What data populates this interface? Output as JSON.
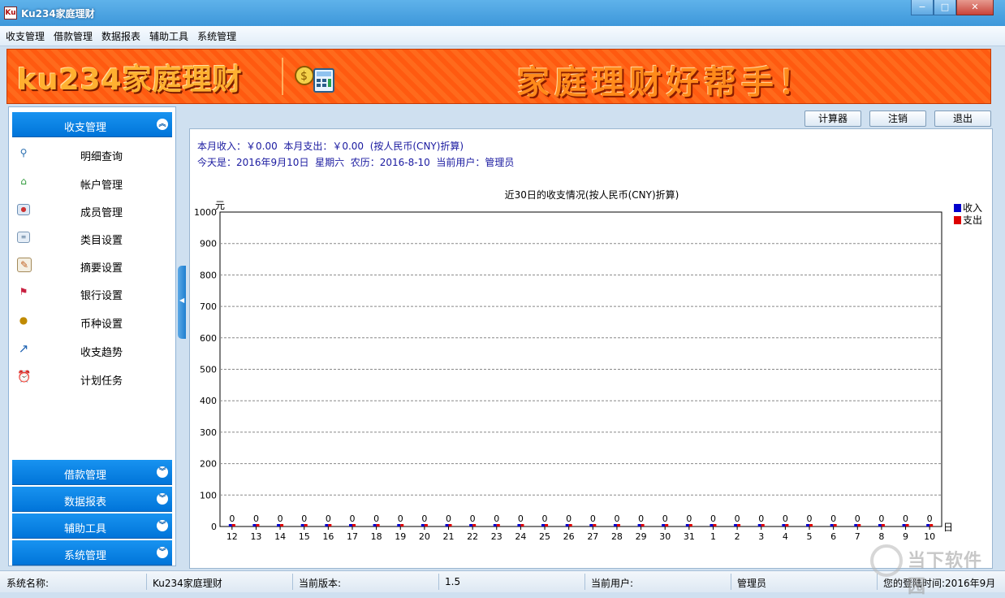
{
  "window": {
    "title": "Ku234家庭理财",
    "icon_text": "Ku",
    "buttons": [
      "−",
      "□",
      "✕"
    ]
  },
  "menubar": {
    "items": [
      "收支管理",
      "借款管理",
      "数据报表",
      "辅助工具",
      "系统管理"
    ]
  },
  "banner": {
    "logo": "ku234家庭理财",
    "slogan": "家庭理财好帮手！"
  },
  "sidebar": {
    "open_section": "收支管理",
    "items": [
      {
        "label": "明细查询",
        "icon": "search-icon"
      },
      {
        "label": "帐户管理",
        "icon": "home-icon"
      },
      {
        "label": "成员管理",
        "icon": "id-card-icon"
      },
      {
        "label": "类目设置",
        "icon": "list-box-icon"
      },
      {
        "label": "摘要设置",
        "icon": "pencil-note-icon"
      },
      {
        "label": "银行设置",
        "icon": "bank-icon"
      },
      {
        "label": "币种设置",
        "icon": "money-bag-icon"
      },
      {
        "label": "收支趋势",
        "icon": "trend-arrow-icon"
      },
      {
        "label": "计划任务",
        "icon": "alarm-clock-icon"
      }
    ],
    "sections": [
      "借款管理",
      "数据报表",
      "辅助工具",
      "系统管理"
    ]
  },
  "toolbar": {
    "calculator": "计算器",
    "logout": "注销",
    "exit": "退出"
  },
  "info": {
    "line1": "本月收入：￥0.00  本月支出：￥0.00  (按人民币(CNY)折算)",
    "line2": "今天是：2016年9月10日  星期六  农历：2016-8-10  当前用户：管理员"
  },
  "chart_data": {
    "type": "bar",
    "title": "近30日的收支情况(按人民币(CNY)折算)",
    "ylabel": "元",
    "xlabel": "日",
    "ylim": [
      0,
      1000
    ],
    "yticks": [
      0,
      100,
      200,
      300,
      400,
      500,
      600,
      700,
      800,
      900,
      1000
    ],
    "grid": true,
    "legend": "top-right",
    "categories": [
      "12",
      "13",
      "14",
      "15",
      "16",
      "17",
      "18",
      "19",
      "20",
      "21",
      "22",
      "23",
      "24",
      "25",
      "26",
      "27",
      "28",
      "29",
      "30",
      "31",
      "1",
      "2",
      "3",
      "4",
      "5",
      "6",
      "7",
      "8",
      "9",
      "10"
    ],
    "series": [
      {
        "name": "收入",
        "color": "#0000cc",
        "values": [
          0,
          0,
          0,
          0,
          0,
          0,
          0,
          0,
          0,
          0,
          0,
          0,
          0,
          0,
          0,
          0,
          0,
          0,
          0,
          0,
          0,
          0,
          0,
          0,
          0,
          0,
          0,
          0,
          0,
          0
        ]
      },
      {
        "name": "支出",
        "color": "#dd0000",
        "values": [
          0,
          0,
          0,
          0,
          0,
          0,
          0,
          0,
          0,
          0,
          0,
          0,
          0,
          0,
          0,
          0,
          0,
          0,
          0,
          0,
          0,
          0,
          0,
          0,
          0,
          0,
          0,
          0,
          0,
          0
        ]
      }
    ],
    "data_labels": [
      "0",
      "0",
      "0",
      "0",
      "0",
      "0",
      "0",
      "0",
      "0",
      "0",
      "0",
      "0",
      "0",
      "0",
      "0",
      "0",
      "0",
      "0",
      "0",
      "0",
      "0",
      "0",
      "0",
      "0",
      "0",
      "0",
      "0",
      "0",
      "0",
      "0"
    ]
  },
  "statusbar": {
    "name_label": "系统名称:",
    "name_value": "Ku234家庭理财",
    "version_label": "当前版本:",
    "version_value": "1.5",
    "user_label": "当前用户:",
    "user_value": "管理员",
    "login_time": "您的登陆时间:2016年9月"
  },
  "watermark": {
    "text": "当下软件园"
  }
}
